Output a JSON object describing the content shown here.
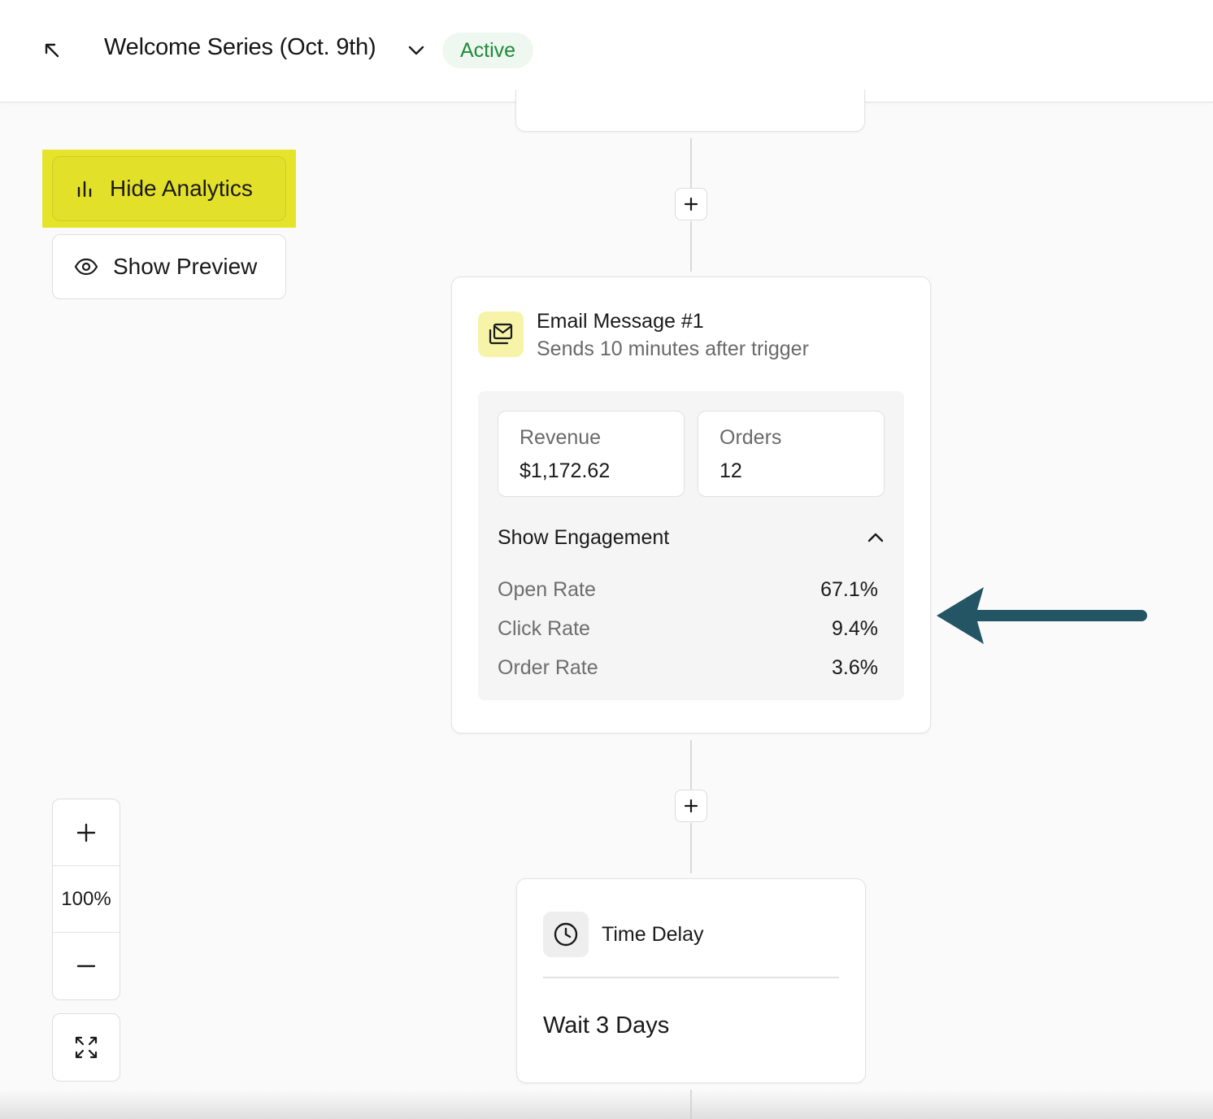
{
  "header": {
    "title": "Welcome Series (Oct. 9th)",
    "status": "Active",
    "icons": {
      "back": "arrow-up-left-icon",
      "dropdown": "chevron-down-icon"
    }
  },
  "controls": {
    "hide_analytics_label": "Hide Analytics",
    "show_preview_label": "Show Preview",
    "icons": {
      "analytics": "bar-chart-icon",
      "preview": "eye-icon"
    }
  },
  "email_step": {
    "title": "Email Message #1",
    "subtitle": "Sends 10 minutes after trigger",
    "icon": "email-stack-icon",
    "metrics": [
      {
        "label": "Revenue",
        "value": "$1,172.62"
      },
      {
        "label": "Orders",
        "value": "12"
      }
    ],
    "engagement_toggle_label": "Show Engagement",
    "engagement": [
      {
        "label": "Open Rate",
        "value": "67.1%"
      },
      {
        "label": "Click Rate",
        "value": "9.4%"
      },
      {
        "label": "Order Rate",
        "value": "3.6%"
      }
    ]
  },
  "delay_step": {
    "title": "Time Delay",
    "value": "Wait 3 Days",
    "icon": "clock-icon"
  },
  "zoom": {
    "level": "100%",
    "icons": {
      "in": "plus-icon",
      "out": "minus-icon",
      "fit": "fit-screen-icon"
    }
  },
  "colors": {
    "highlight": "#e6e42a",
    "status_text": "#1f8a3a",
    "status_bg": "#eef8f0",
    "annotation_arrow": "#245565"
  }
}
